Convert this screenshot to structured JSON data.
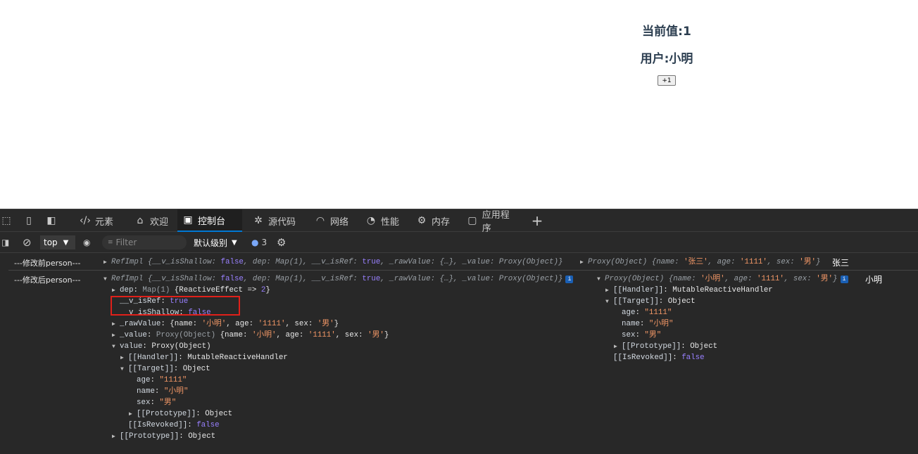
{
  "page": {
    "current_value": "当前值:1",
    "user": "用户:小明",
    "increment_button": "+1"
  },
  "devtools": {
    "tabs": [
      {
        "label": "元素",
        "icon": "code-icon"
      },
      {
        "label": "欢迎",
        "icon": "home-icon"
      },
      {
        "label": "控制台",
        "icon": "console-icon",
        "active": true
      },
      {
        "label": "源代码",
        "icon": "bug-icon"
      },
      {
        "label": "网络",
        "icon": "wifi-icon"
      },
      {
        "label": "性能",
        "icon": "gauge-icon"
      },
      {
        "label": "内存",
        "icon": "chip-icon"
      },
      {
        "label": "应用程序",
        "icon": "app-icon"
      }
    ],
    "toolbar": {
      "context": "top",
      "filter_placeholder": "Filter",
      "level": "默认级别",
      "issues_count": "3"
    },
    "accent": "#0078d4"
  },
  "console": {
    "row1": {
      "label": "---修改前person---",
      "tail": "张三",
      "lines": [
        {
          "depth": 0,
          "side": "left",
          "tri": "right",
          "segs": [
            [
              "p",
              "RefImpl {__v_isShallow: "
            ],
            [
              "b",
              "false"
            ],
            [
              "p",
              ", dep: Map(1), __v_isRef: "
            ],
            [
              "b",
              "true"
            ],
            [
              "p",
              ", _rawValue: {…}, _value: Proxy(Object)}"
            ]
          ]
        },
        {
          "depth": 0,
          "side": "right",
          "tri": "right",
          "segs": [
            [
              "p",
              "Proxy(Object) {name: "
            ],
            [
              "s",
              "'张三'"
            ],
            [
              "p",
              ", age: "
            ],
            [
              "s",
              "'1111'"
            ],
            [
              "p",
              ", sex: "
            ],
            [
              "s",
              "'男'"
            ],
            [
              "p",
              "}"
            ]
          ]
        }
      ]
    },
    "row2": {
      "label": "---修改后person---",
      "tail": "小明",
      "left": [
        {
          "depth": 0,
          "tri": "down",
          "info": true,
          "segs": [
            [
              "p",
              "RefImpl {__v_isShallow: "
            ],
            [
              "b",
              "false"
            ],
            [
              "p",
              ", dep: Map(1), __v_isRef: "
            ],
            [
              "b",
              "true"
            ],
            [
              "p",
              ", _rawValue: {…}, _value: Proxy(Object)}"
            ]
          ]
        },
        {
          "depth": 1,
          "tri": "right",
          "segs": [
            [
              "k",
              "dep"
            ],
            [
              "o",
              ": "
            ],
            [
              "g",
              "Map(1) "
            ],
            [
              "o",
              "{ReactiveEffect => "
            ],
            [
              "b",
              "2"
            ],
            [
              "o",
              "}"
            ]
          ]
        },
        {
          "depth": 1,
          "segs": [
            [
              "k",
              "__v_isRef"
            ],
            [
              "o",
              ": "
            ],
            [
              "b",
              "true"
            ]
          ]
        },
        {
          "depth": 1,
          "segs": [
            [
              "k",
              "__v_isShallow"
            ],
            [
              "o",
              ": "
            ],
            [
              "b",
              "false"
            ]
          ]
        },
        {
          "depth": 1,
          "tri": "right",
          "segs": [
            [
              "k",
              "_rawValue"
            ],
            [
              "o",
              ": {name: "
            ],
            [
              "s",
              "'小明'"
            ],
            [
              "o",
              ", age: "
            ],
            [
              "s",
              "'1111'"
            ],
            [
              "o",
              ", sex: "
            ],
            [
              "s",
              "'男'"
            ],
            [
              "o",
              "}"
            ]
          ]
        },
        {
          "depth": 1,
          "tri": "right",
          "segs": [
            [
              "k",
              "_value"
            ],
            [
              "o",
              ": "
            ],
            [
              "g",
              "Proxy(Object) "
            ],
            [
              "o",
              "{name: "
            ],
            [
              "s",
              "'小明'"
            ],
            [
              "o",
              ", age: "
            ],
            [
              "s",
              "'1111'"
            ],
            [
              "o",
              ", sex: "
            ],
            [
              "s",
              "'男'"
            ],
            [
              "o",
              "}"
            ]
          ]
        },
        {
          "depth": 1,
          "tri": "down",
          "segs": [
            [
              "k",
              "value"
            ],
            [
              "o",
              ": Proxy(Object)"
            ]
          ]
        },
        {
          "depth": 2,
          "tri": "right",
          "segs": [
            [
              "k",
              "[[Handler]]"
            ],
            [
              "o",
              ": MutableReactiveHandler"
            ]
          ]
        },
        {
          "depth": 2,
          "tri": "down",
          "segs": [
            [
              "k",
              "[[Target]]"
            ],
            [
              "o",
              ": Object"
            ]
          ]
        },
        {
          "depth": 3,
          "segs": [
            [
              "k",
              "age"
            ],
            [
              "o",
              ": "
            ],
            [
              "s",
              "\"1111\""
            ]
          ]
        },
        {
          "depth": 3,
          "segs": [
            [
              "k",
              "name"
            ],
            [
              "o",
              ": "
            ],
            [
              "s",
              "\"小明\""
            ]
          ]
        },
        {
          "depth": 3,
          "segs": [
            [
              "k",
              "sex"
            ],
            [
              "o",
              ": "
            ],
            [
              "s",
              "\"男\""
            ]
          ]
        },
        {
          "depth": 3,
          "tri": "right",
          "segs": [
            [
              "k",
              "[[Prototype]]"
            ],
            [
              "o",
              ": Object"
            ]
          ]
        },
        {
          "depth": 2,
          "segs": [
            [
              "k",
              "[[IsRevoked]]"
            ],
            [
              "o",
              ": "
            ],
            [
              "b",
              "false"
            ]
          ]
        },
        {
          "depth": 1,
          "tri": "right",
          "segs": [
            [
              "k",
              "[[Prototype]]"
            ],
            [
              "o",
              ": Object"
            ]
          ]
        }
      ],
      "right": [
        {
          "depth": 0,
          "tri": "down",
          "info": true,
          "segs": [
            [
              "p",
              "Proxy(Object) {name: "
            ],
            [
              "s",
              "'小明'"
            ],
            [
              "p",
              ", age: "
            ],
            [
              "s",
              "'1111'"
            ],
            [
              "p",
              ", sex: "
            ],
            [
              "s",
              "'男'"
            ],
            [
              "p",
              "}"
            ]
          ]
        },
        {
          "depth": 1,
          "tri": "right",
          "segs": [
            [
              "k",
              "[[Handler]]"
            ],
            [
              "o",
              ": MutableReactiveHandler"
            ]
          ]
        },
        {
          "depth": 1,
          "tri": "down",
          "segs": [
            [
              "k",
              "[[Target]]"
            ],
            [
              "o",
              ": Object"
            ]
          ]
        },
        {
          "depth": 2,
          "segs": [
            [
              "k",
              "age"
            ],
            [
              "o",
              ": "
            ],
            [
              "s",
              "\"1111\""
            ]
          ]
        },
        {
          "depth": 2,
          "segs": [
            [
              "k",
              "name"
            ],
            [
              "o",
              ": "
            ],
            [
              "s",
              "\"小明\""
            ]
          ]
        },
        {
          "depth": 2,
          "segs": [
            [
              "k",
              "sex"
            ],
            [
              "o",
              ": "
            ],
            [
              "s",
              "\"男\""
            ]
          ]
        },
        {
          "depth": 2,
          "tri": "right",
          "segs": [
            [
              "k",
              "[[Prototype]]"
            ],
            [
              "o",
              ": Object"
            ]
          ]
        },
        {
          "depth": 1,
          "segs": [
            [
              "k",
              "[[IsRevoked]]"
            ],
            [
              "o",
              ": "
            ],
            [
              "b",
              "false"
            ]
          ]
        }
      ]
    }
  }
}
